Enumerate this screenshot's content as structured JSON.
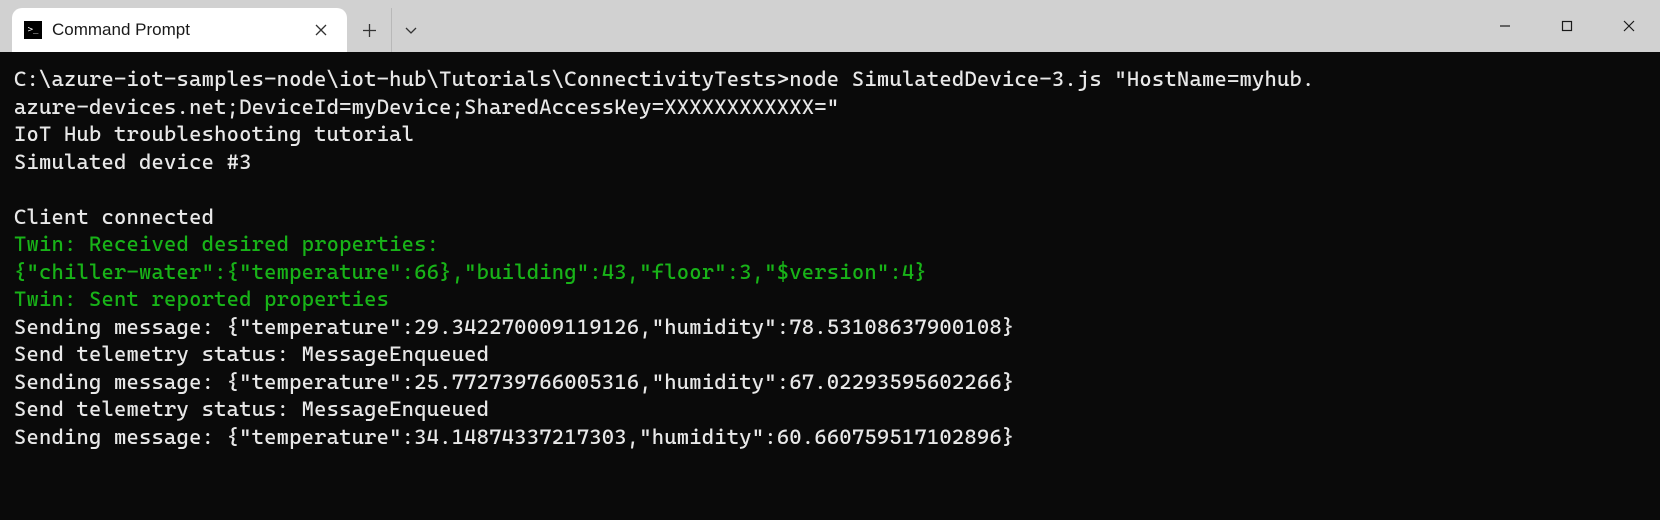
{
  "tab": {
    "title": "Command Prompt"
  },
  "terminal": {
    "lines": [
      {
        "text": "C:\\azure-iot-samples-node\\iot-hub\\Tutorials\\ConnectivityTests>node SimulatedDevice-3.js \"HostName=myhub.",
        "color": "white"
      },
      {
        "text": "azure-devices.net;DeviceId=myDevice;SharedAccessKey=XXXXXXXXXXXX=\"",
        "color": "white"
      },
      {
        "text": "IoT Hub troubleshooting tutorial",
        "color": "white"
      },
      {
        "text": "Simulated device #3",
        "color": "white"
      },
      {
        "text": "",
        "color": "white"
      },
      {
        "text": "Client connected",
        "color": "white"
      },
      {
        "text": "Twin: Received desired properties:",
        "color": "green"
      },
      {
        "text": "{\"chiller-water\":{\"temperature\":66},\"building\":43,\"floor\":3,\"$version\":4}",
        "color": "green"
      },
      {
        "text": "Twin: Sent reported properties",
        "color": "green"
      },
      {
        "text": "Sending message: {\"temperature\":29.342270009119126,\"humidity\":78.53108637900108}",
        "color": "white"
      },
      {
        "text": "Send telemetry status: MessageEnqueued",
        "color": "white"
      },
      {
        "text": "Sending message: {\"temperature\":25.772739766005316,\"humidity\":67.02293595602266}",
        "color": "white"
      },
      {
        "text": "Send telemetry status: MessageEnqueued",
        "color": "white"
      },
      {
        "text": "Sending message: {\"temperature\":34.14874337217303,\"humidity\":60.660759517102896}",
        "color": "white"
      }
    ]
  }
}
